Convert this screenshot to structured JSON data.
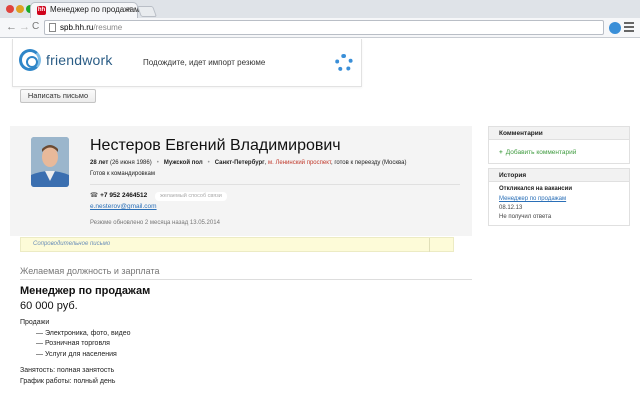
{
  "browser": {
    "tab_title": "Менеджер по продажам",
    "tab_favicon_letter": "hh",
    "tab_close": "×",
    "url_host": "spb.hh.ru",
    "url_path": "/resume",
    "back": "←",
    "forward": "→",
    "reload": "C"
  },
  "import_banner": {
    "logo_text": "friendwork",
    "status": "Подождите, идет импорт резюме"
  },
  "write_button": "Написать письмо",
  "resume": {
    "name": "Нестеров Евгений Владимирович",
    "age": "28 лет",
    "birth_date": "(26 июня 1986)",
    "gender": "Мужской пол",
    "city": "Санкт-Петербург",
    "metro": "м. Ленинский проспект",
    "relocation": ", готов к переезду (Москва)",
    "trips": "Готов к командировкам",
    "phone": "+7 952 2464512",
    "phone_pref": "желаемый способ связи",
    "email": "e.nesterov@gmail.com",
    "updated": "Резюме обновлено 2 месяца назад   13.05.2014",
    "cover_letter": "Сопроводительное письмо"
  },
  "position": {
    "section_title": "Желаемая должность и зарплата",
    "title": "Менеджер по продажам",
    "salary": "60 000 руб.",
    "specialization": "Продажи",
    "items": [
      "— Электроника, фото, видео",
      "— Розничная торговля",
      "— Услуги для населения"
    ],
    "employment": "Занятость: полная занятость",
    "schedule": "График работы: полный день"
  },
  "sidebar": {
    "comments_title": "Комментарии",
    "add_comment": "Добавить комментарий",
    "add_comment_plus": "+",
    "history_title": "История",
    "history_label": "Откликался на вакансии",
    "history_vacancy": "Менеджер по продажам",
    "history_date": "08.12.13",
    "history_status": "Не получил ответа"
  },
  "colors": {
    "accent_blue": "#2a6fb7",
    "add_green": "#3f9b3f",
    "metro_red": "#c0392b",
    "cover_yellow": "#fdfbd8"
  }
}
